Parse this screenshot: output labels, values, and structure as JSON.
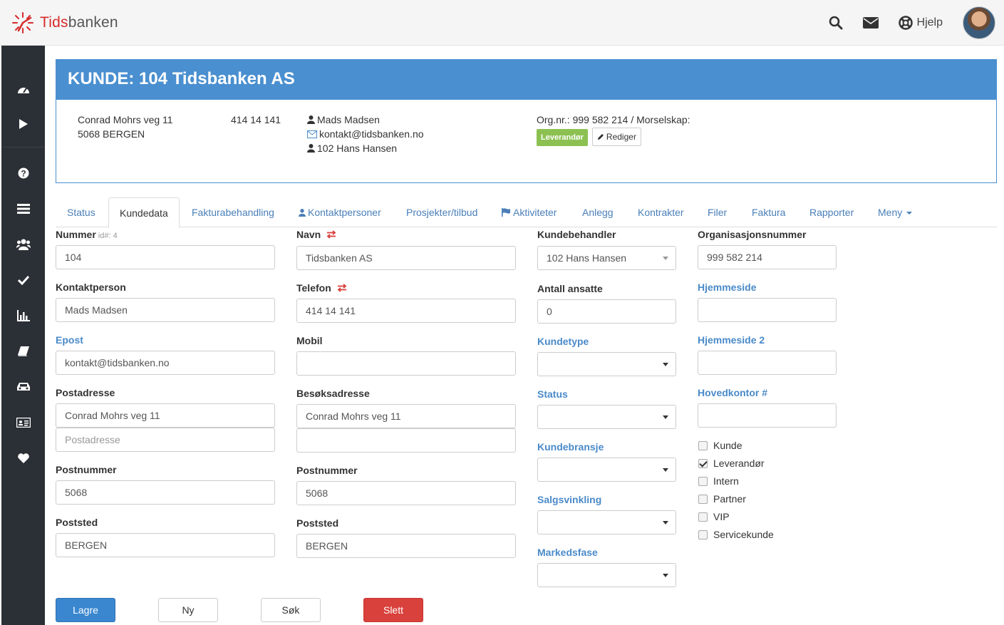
{
  "app": {
    "logo_red": "Tids",
    "logo_rest": "banken",
    "help_label": "Hjelp"
  },
  "customer": {
    "title": "KUNDE: 104 Tidsbanken AS",
    "address1": "Conrad Mohrs veg 11",
    "address2": "5068 BERGEN",
    "phone": "414 14 141",
    "contact": "Mads Madsen",
    "email": "kontakt@tidsbanken.no",
    "handler": "102 Hans Hansen",
    "org": "Org.nr.: 999 582 214 / Morselskap:",
    "badge": "Leverandør",
    "edit_label": "Rediger"
  },
  "tabs": [
    "Status",
    "Kundedata",
    "Fakturabehandling",
    "Kontaktpersoner",
    "Prosjekter/tilbud",
    "Aktiviteter",
    "Anlegg",
    "Kontrakter",
    "Filer",
    "Faktura",
    "Rapporter",
    "Meny"
  ],
  "form": {
    "nummer_label": "Nummer",
    "nummer_id": "id#: 4",
    "nummer": "104",
    "kontaktperson_label": "Kontaktperson",
    "kontaktperson": "Mads Madsen",
    "epost_label": "Epost",
    "epost": "kontakt@tidsbanken.no",
    "postadresse_label": "Postadresse",
    "postadresse": "Conrad Mohrs veg 11",
    "postadresse2_placeholder": "Postadresse",
    "postnummer_label": "Postnummer",
    "postnummer": "5068",
    "poststed_label": "Poststed",
    "poststed": "BERGEN",
    "navn_label": "Navn",
    "navn": "Tidsbanken AS",
    "telefon_label": "Telefon",
    "telefon": "414 14 141",
    "mobil_label": "Mobil",
    "mobil": "",
    "besok_label": "Besøksadresse",
    "besok": "Conrad Mohrs veg 11",
    "besok2": "",
    "postnummer2_label": "Postnummer",
    "postnummer2": "5068",
    "poststed2_label": "Poststed",
    "poststed2": "BERGEN",
    "kundebehandler_label": "Kundebehandler",
    "kundebehandler": "102 Hans Hansen",
    "ansatte_label": "Antall ansatte",
    "ansatte": "0",
    "kundetype_label": "Kundetype",
    "status_label": "Status",
    "bransje_label": "Kundebransje",
    "salg_label": "Salgsvinkling",
    "marked_label": "Markedsfase",
    "orgnr_label": "Organisasjonsnummer",
    "orgnr": "999 582 214",
    "hjemmeside_label": "Hjemmeside",
    "hjemmeside": "",
    "hjemmeside2_label": "Hjemmeside 2",
    "hjemmeside2": "",
    "hovedkontor_label": "Hovedkontor #",
    "hovedkontor": ""
  },
  "checkboxes": [
    {
      "label": "Kunde",
      "checked": false
    },
    {
      "label": "Leverandør",
      "checked": true
    },
    {
      "label": "Intern",
      "checked": false
    },
    {
      "label": "Partner",
      "checked": false
    },
    {
      "label": "VIP",
      "checked": false
    },
    {
      "label": "Servicekunde",
      "checked": false
    }
  ],
  "buttons": {
    "save": "Lagre",
    "new": "Ny",
    "search": "Søk",
    "delete": "Slett"
  },
  "colors": {
    "header_blue": "#4a8fd0",
    "primary": "#3a87cf",
    "danger": "#d9413c",
    "badge_green": "#8cc152",
    "link": "#4a8ac9"
  }
}
